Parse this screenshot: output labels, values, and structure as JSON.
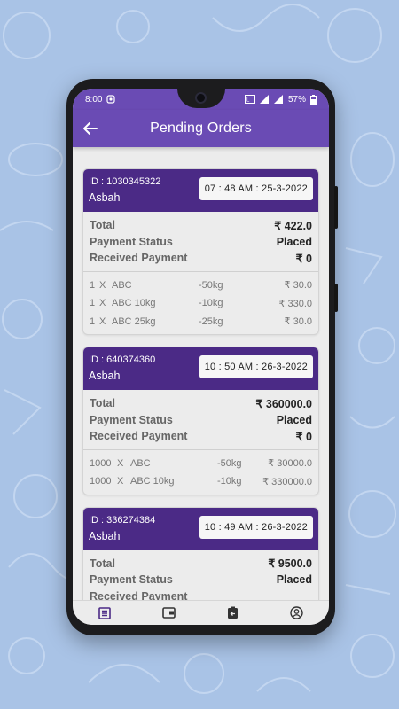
{
  "status_bar": {
    "time": "8:00",
    "battery": "57%"
  },
  "app_bar": {
    "title": "Pending Orders"
  },
  "labels": {
    "total": "Total",
    "payment_status": "Payment Status",
    "received_payment": "Received Payment"
  },
  "orders": [
    {
      "id": "ID : 1030345322",
      "customer": "Asbah",
      "datetime": "07 : 48 AM : 25-3-2022",
      "total": "₹ 422.0",
      "payment_status": "Placed",
      "received_payment": "₹ 0",
      "items": [
        {
          "qty": "1",
          "x": "X",
          "name": "ABC",
          "weight": "-50kg",
          "price": "₹ 30.0"
        },
        {
          "qty": "1",
          "x": "X",
          "name": "ABC 10kg",
          "weight": "-10kg",
          "price": "₹ 330.0"
        },
        {
          "qty": "1",
          "x": "X",
          "name": "ABC 25kg",
          "weight": "-25kg",
          "price": "₹ 30.0"
        }
      ]
    },
    {
      "id": "ID : 640374360",
      "customer": "Asbah",
      "datetime": "10 : 50 AM : 26-3-2022",
      "total": "₹ 360000.0",
      "payment_status": "Placed",
      "received_payment": "₹ 0",
      "items": [
        {
          "qty": "1000",
          "x": "X",
          "name": "ABC",
          "weight": "-50kg",
          "price": "₹ 30000.0"
        },
        {
          "qty": "1000",
          "x": "X",
          "name": "ABC 10kg",
          "weight": "-10kg",
          "price": "₹ 330000.0"
        }
      ]
    },
    {
      "id": "ID : 336274384",
      "customer": "Asbah",
      "datetime": "10 : 49 AM : 26-3-2022",
      "total": "₹ 9500.0",
      "payment_status": "Placed",
      "received_payment": "Received Payment",
      "items": []
    }
  ],
  "bottom_nav": [
    "orders-list-icon",
    "wallet-icon",
    "return-icon",
    "profile-icon"
  ],
  "colors": {
    "primary": "#6a4bb4",
    "card_header": "#4b2a86",
    "background": "#a9c3e6"
  }
}
